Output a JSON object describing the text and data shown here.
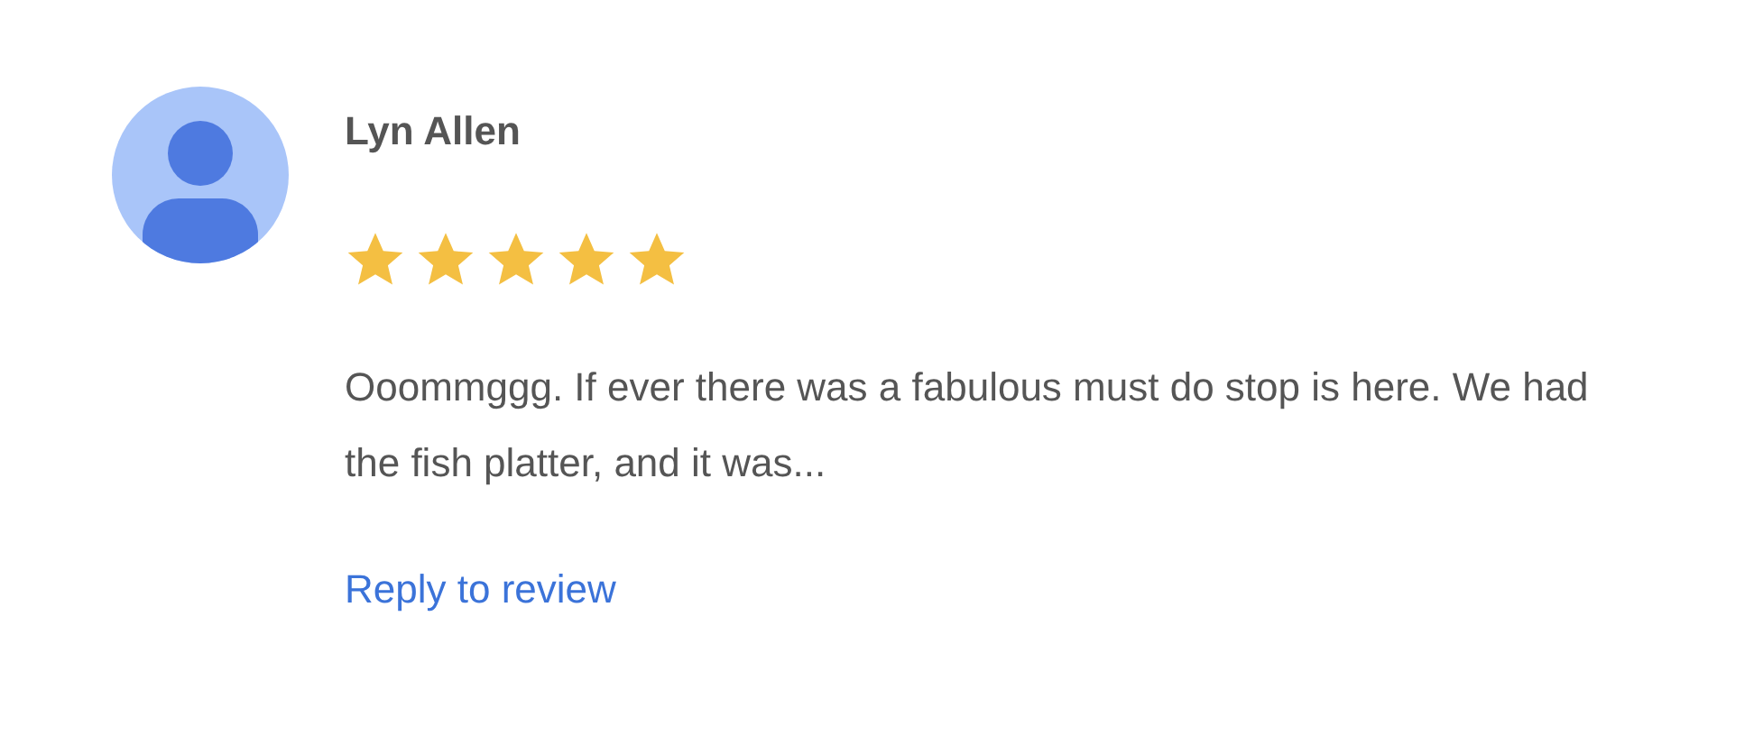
{
  "review": {
    "author": "Lyn Allen",
    "stars": 5,
    "text": "Ooommggg. If ever there was a fabulous must do stop is here. We had the fish platter, and it was...",
    "reply_link": "Reply to review"
  }
}
